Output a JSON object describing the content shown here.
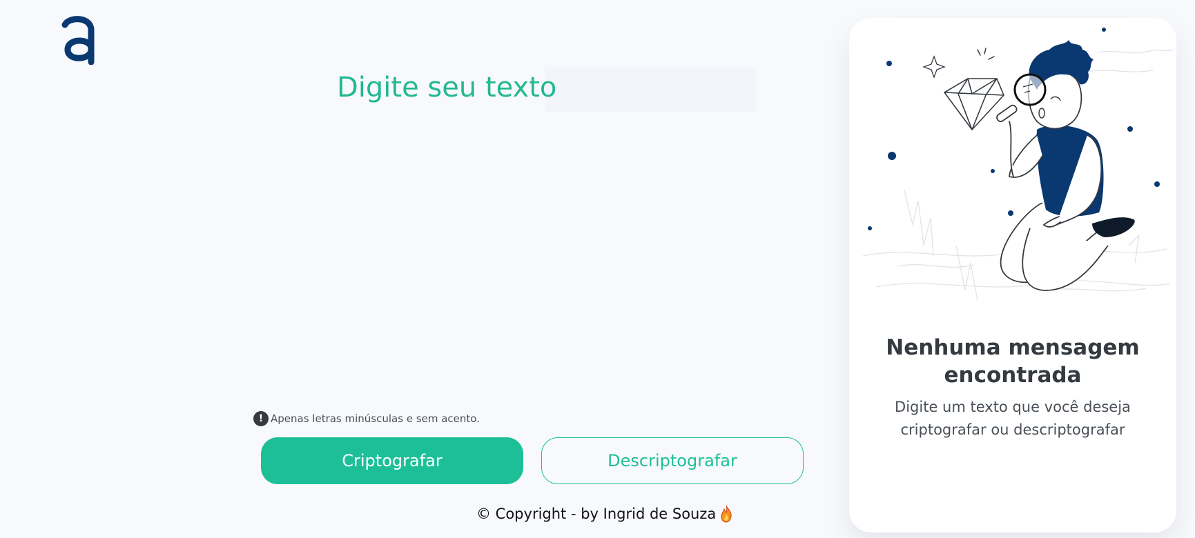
{
  "brand": {
    "logo_icon": "alura-a-logo",
    "logo_color": "#0A3871"
  },
  "input": {
    "placeholder": "Digite seu texto",
    "value": ""
  },
  "hint": {
    "icon": "exclamation-circle-icon",
    "text": "Apenas letras minúsculas e sem acento."
  },
  "buttons": {
    "encrypt_label": "Criptografar",
    "decrypt_label": "Descriptografar"
  },
  "footer": {
    "text": "© Copyright - by Ingrid de Souza",
    "icon": "fire-emoji-icon"
  },
  "result": {
    "illustration": "person-with-magnifier-illustration",
    "title": "Nenhuma mensagem encontrada",
    "message": "Digite um texto que você deseja criptografar ou descriptografar"
  },
  "colors": {
    "accent": "#1DBF98",
    "brand_dark": "#0A3871",
    "background": "#F8F9FD",
    "card": "#FFFFFF"
  }
}
